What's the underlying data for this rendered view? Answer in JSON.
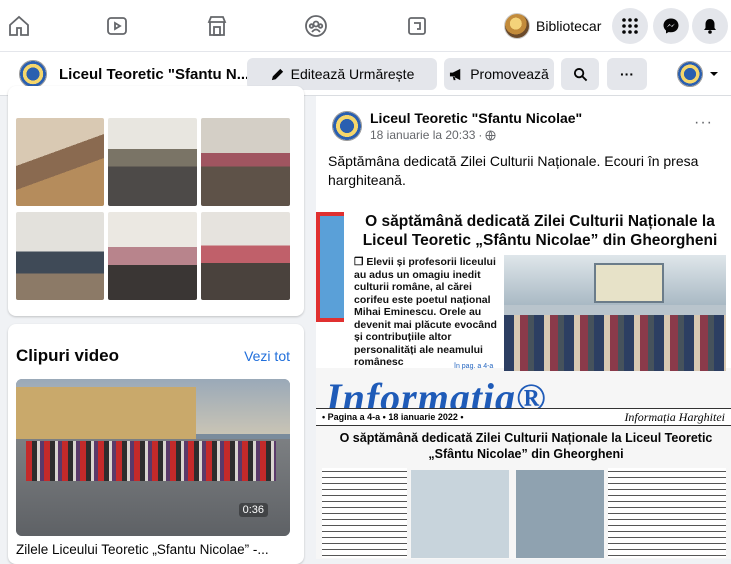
{
  "topbar": {
    "icons": [
      "home-icon",
      "video-icon",
      "marketplace-icon",
      "groups-icon",
      "gaming-icon"
    ],
    "profile_name": "Bibliotecar",
    "right_icons": [
      "menu-grid-icon",
      "messenger-icon",
      "notifications-icon"
    ]
  },
  "pagebar": {
    "page_name": "Liceul Teoretic \"Sfantu N...",
    "edit_label": "Editează Urmărește",
    "promote_label": "Promovează",
    "more_label": "···"
  },
  "left": {
    "clips_title": "Clipuri video",
    "see_all": "Vezi tot",
    "video_duration": "0:36",
    "video_caption": "Zilele Liceului Teoretic „Sfantu Nicolae” -..."
  },
  "post": {
    "author": "Liceul Teoretic \"Sfantu Nicolae\"",
    "date": "18 ianuarie la 20:33",
    "more": "···",
    "text": "Săptămâna dedicată Zilei Culturii Naționale. Ecouri în presa harghiteană.",
    "newspaper": {
      "headline": "O săptămână dedicată Zilei Culturii Naționale la Liceul Teoretic „Sfântu Nicolae” din Gheorgheni",
      "body": "❒ Elevii și profesorii liceului au adus un omagiu inedit culturii române, al cărei corifeu este poetul național Mihai Eminescu. Orele au devenit mai plăcute evocând și contribuțiile altor personalități ale neamului românesc",
      "page_ref": "în pag. a 4-a",
      "logo": "Informația®",
      "strip_left": "• Pagina a 4-a • 18 ianuarie 2022 •",
      "strip_right": "Informația Harghitei",
      "headline2": "O săptămână dedicată Zilei Culturii Naționale la Liceul Teoretic „Sfântu Nicolae” din Gheorgheni"
    }
  },
  "colors": {
    "accent": "#216fdb",
    "background": "#f0f2f5",
    "button_gray": "#e4e6eb",
    "newspaper_red": "#e03030",
    "newspaper_blue": "#1f5bb8"
  }
}
